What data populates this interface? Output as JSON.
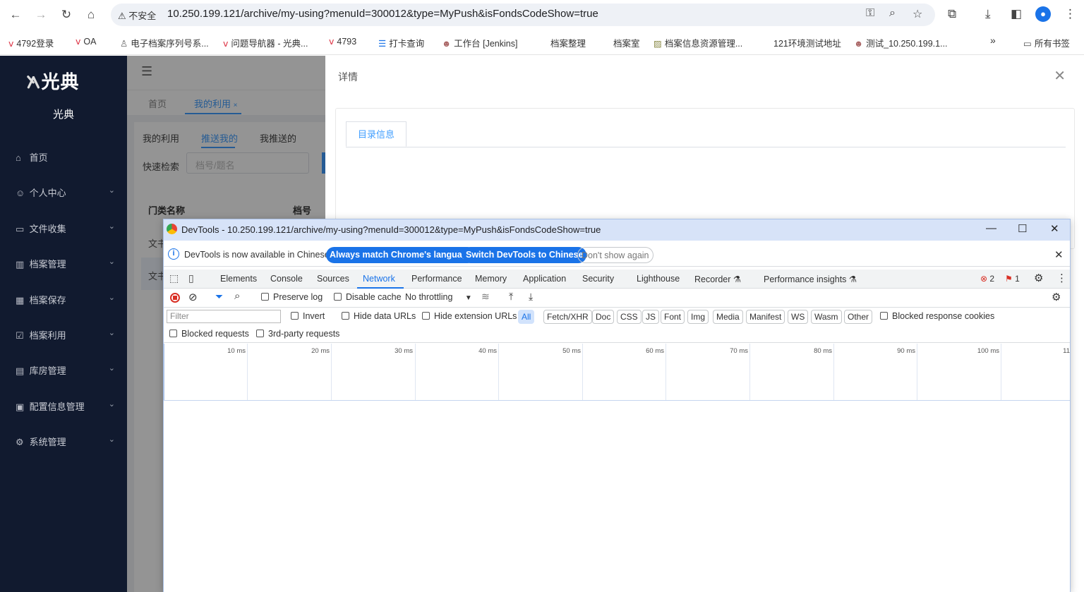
{
  "browser": {
    "insecure_label": "不安全",
    "url": "10.250.199.121/archive/my-using?menuId=300012&type=MyPush&isFondsCodeShow=true",
    "bookmarks": [
      "4792登录",
      "OA",
      "电子档案序列号系...",
      "问题导航器 - 光典...",
      "4793",
      "打卡查询",
      "工作台 [Jenkins]",
      "档案整理",
      "档案室",
      "档案信息资源管理...",
      "121环境测试地址",
      "测试_10.250.199.1..."
    ],
    "overflow": "»",
    "all_bookmarks": "所有书签"
  },
  "app": {
    "logo": "光典",
    "system_name": "光典",
    "menu": [
      {
        "label": "首页",
        "icon": "home-icon",
        "glyph": "⌂",
        "expand": false
      },
      {
        "label": "个人中心",
        "icon": "user-icon",
        "glyph": "☺",
        "expand": true
      },
      {
        "label": "文件收集",
        "icon": "folder-icon",
        "glyph": "▭",
        "expand": true
      },
      {
        "label": "档案管理",
        "icon": "bank-icon",
        "glyph": "▥",
        "expand": true
      },
      {
        "label": "档案保存",
        "icon": "building-icon",
        "glyph": "▦",
        "expand": true
      },
      {
        "label": "档案利用",
        "icon": "checklist-icon",
        "glyph": "☑",
        "expand": true
      },
      {
        "label": "库房管理",
        "icon": "warehouse-icon",
        "glyph": "▤",
        "expand": true
      },
      {
        "label": "配置信息管理",
        "icon": "clipboard-icon",
        "glyph": "▣",
        "expand": true
      },
      {
        "label": "系统管理",
        "icon": "gear-icon",
        "glyph": "⚙",
        "expand": true
      }
    ],
    "tags": {
      "home": "首页",
      "current": "我的利用"
    },
    "subtabs": [
      "我的利用",
      "推送我的",
      "我推送的"
    ],
    "quick_search_label": "快速检索",
    "quick_search_placeholder": "档号/题名",
    "table_headers": [
      "门类名称",
      "档号"
    ],
    "row_fragments": [
      "文书",
      "文书"
    ]
  },
  "drawer": {
    "title": "详情",
    "tab": "目录信息"
  },
  "devtools": {
    "window_title": "DevTools - 10.250.199.121/archive/my-using?menuId=300012&type=MyPush&isFondsCodeShow=true",
    "info_text": "DevTools is now available in Chinese!",
    "btn_match": "Always match Chrome's language",
    "btn_switch": "Switch DevTools to Chinese",
    "btn_dont": "Don't show again",
    "tabs": [
      "Elements",
      "Console",
      "Sources",
      "Network",
      "Performance",
      "Memory",
      "Application",
      "Security",
      "Lighthouse",
      "Recorder",
      "Performance insights"
    ],
    "selected_tab": "Network",
    "error_count": "2",
    "issue_count": "1",
    "preserve_log": "Preserve log",
    "disable_cache": "Disable cache",
    "throttling": "No throttling",
    "filter_placeholder": "Filter",
    "invert": "Invert",
    "hide_data_urls": "Hide data URLs",
    "hide_ext_urls": "Hide extension URLs",
    "type_filters": [
      "All",
      "Fetch/XHR",
      "Doc",
      "CSS",
      "JS",
      "Font",
      "Img",
      "Media",
      "Manifest",
      "WS",
      "Wasm",
      "Other"
    ],
    "blocked_cookies": "Blocked response cookies",
    "blocked_requests": "Blocked requests",
    "third_party": "3rd-party requests",
    "timeline_ticks": [
      "10 ms",
      "20 ms",
      "30 ms",
      "40 ms",
      "50 ms",
      "60 ms",
      "70 ms",
      "80 ms",
      "90 ms",
      "100 ms",
      "11"
    ]
  }
}
